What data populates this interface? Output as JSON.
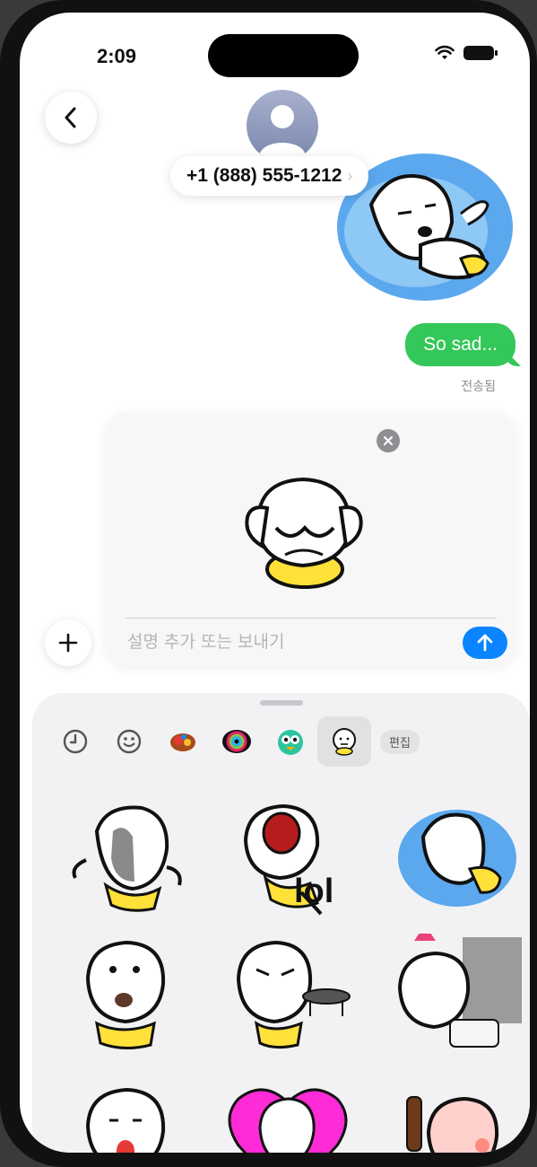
{
  "status_bar": {
    "time": "2:09"
  },
  "header": {
    "contact": "+1 (888) 555-1212",
    "contact_chevron": "›"
  },
  "messages": {
    "text": "So sad...",
    "delivered": "전송됨"
  },
  "compose": {
    "placeholder": "설명 추가 또는 보내기"
  },
  "drawer": {
    "tabs": [
      {
        "icon": "clock-icon"
      },
      {
        "icon": "emoji-smile-icon"
      },
      {
        "icon": "sticker-pack-1-icon"
      },
      {
        "icon": "sticker-pack-2-icon"
      },
      {
        "icon": "sticker-pack-3-icon"
      },
      {
        "icon": "sticker-pack-active-icon"
      }
    ],
    "edit_label": "편집",
    "lol_text": "lol"
  },
  "colors": {
    "accent_blue": "#0a84ff",
    "bubble_green": "#34c759",
    "drawer_bg": "#f2f2f4"
  }
}
